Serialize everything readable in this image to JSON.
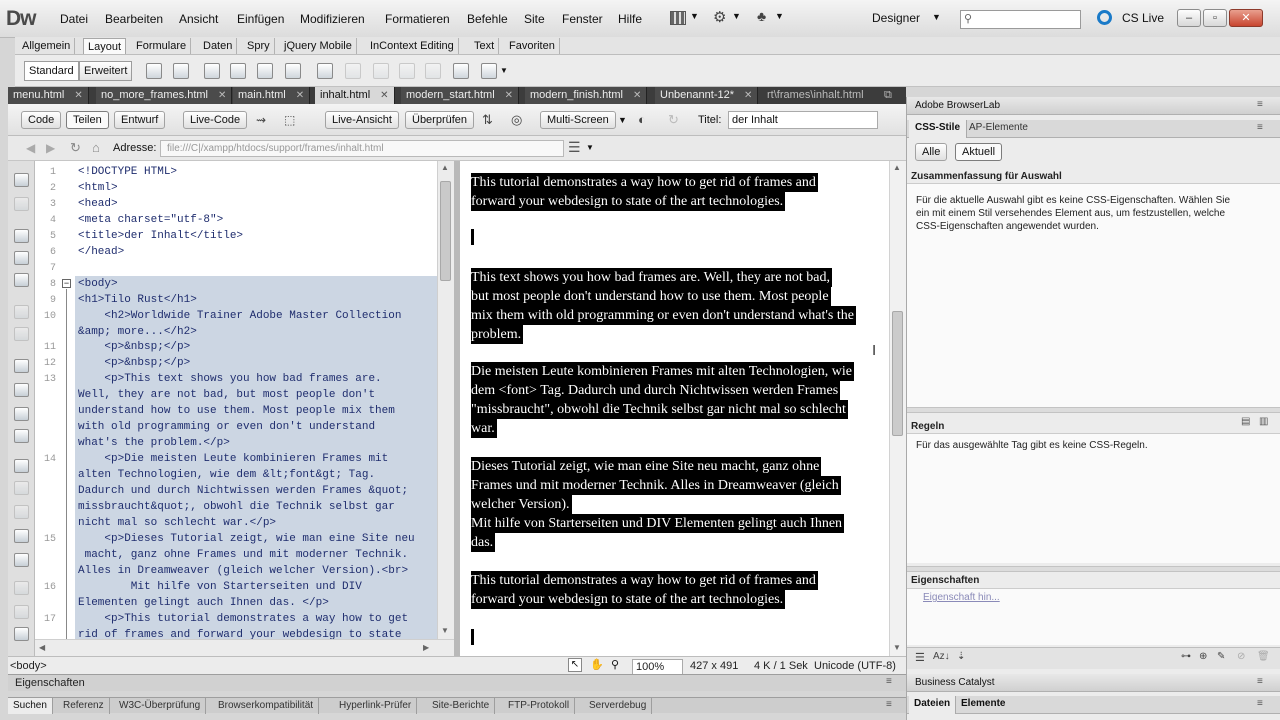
{
  "app": {
    "logo": "Dw"
  },
  "menu": [
    "Datei",
    "Bearbeiten",
    "Ansicht",
    "Einfügen",
    "Modifizieren",
    "Formatieren",
    "Befehle",
    "Site",
    "Fenster",
    "Hilfe"
  ],
  "workspace": "Designer",
  "cslive": "CS Live",
  "insert_tabs": [
    "Allgemein",
    "Layout",
    "Formulare",
    "Daten",
    "Spry",
    "jQuery Mobile",
    "InContext Editing",
    "Text",
    "Favoriten"
  ],
  "insert_active": "Layout",
  "layout_modes": [
    "Standard",
    "Erweitert"
  ],
  "doc_tabs": [
    "menu.html",
    "no_more_frames.html",
    "main.html",
    "inhalt.html",
    "modern_start.html",
    "modern_finish.html",
    "Unbenannt-12*"
  ],
  "doc_path_tab": "rt\\frames\\inhalt.html",
  "view_buttons": {
    "code": "Code",
    "split": "Teilen",
    "design": "Entwurf",
    "live_code": "Live-Code",
    "live_view": "Live-Ansicht",
    "inspect": "Überprüfen",
    "multiscreen": "Multi-Screen"
  },
  "doc_title": {
    "label": "Titel:",
    "value": "der Inhalt"
  },
  "address": {
    "label": "Adresse:",
    "value": "file:///C|/xampp/htdocs/support/frames/inhalt.html"
  },
  "code_lines": [
    {
      "n": "1",
      "t": "<!DOCTYPE HTML>"
    },
    {
      "n": "2",
      "t": "<html>"
    },
    {
      "n": "3",
      "t": "<head>"
    },
    {
      "n": "4",
      "t": "<meta charset=\"utf-8\">"
    },
    {
      "n": "5",
      "t": "<title>der Inhalt</title>"
    },
    {
      "n": "6",
      "t": "</head>"
    },
    {
      "n": "7",
      "t": ""
    },
    {
      "n": "8",
      "t": "<body>"
    },
    {
      "n": "9",
      "t": "<h1>Tilo Rust</h1>"
    },
    {
      "n": "10",
      "t": "    <h2>Worldwide Trainer Adobe Master Collection"
    },
    {
      "n": "",
      "t": "&amp; more...</h2>"
    },
    {
      "n": "11",
      "t": "    <p>&nbsp;</p>"
    },
    {
      "n": "12",
      "t": "    <p>&nbsp;</p>"
    },
    {
      "n": "13",
      "t": "    <p>This text shows you how bad frames are."
    },
    {
      "n": "",
      "t": "Well, they are not bad, but most people don't"
    },
    {
      "n": "",
      "t": "understand how to use them. Most people mix them"
    },
    {
      "n": "",
      "t": "with old programming or even don't understand"
    },
    {
      "n": "",
      "t": "what's the problem.</p>"
    },
    {
      "n": "14",
      "t": "    <p>Die meisten Leute kombinieren Frames mit"
    },
    {
      "n": "",
      "t": "alten Technologien, wie dem &lt;font&gt; Tag."
    },
    {
      "n": "",
      "t": "Dadurch und durch Nichtwissen werden Frames &quot;"
    },
    {
      "n": "",
      "t": "missbraucht&quot;, obwohl die Technik selbst gar"
    },
    {
      "n": "",
      "t": "nicht mal so schlecht war.</p>"
    },
    {
      "n": "15",
      "t": "    <p>Dieses Tutorial zeigt, wie man eine Site neu"
    },
    {
      "n": "",
      "t": " macht, ganz ohne Frames und mit moderner Technik."
    },
    {
      "n": "",
      "t": "Alles in Dreamweaver (gleich welcher Version).<br>"
    },
    {
      "n": "16",
      "t": "        Mit hilfe von Starterseiten und DIV"
    },
    {
      "n": "",
      "t": "Elementen gelingt auch Ihnen das. </p>"
    },
    {
      "n": "17",
      "t": "    <p>This tutorial demonstrates a way how to get"
    },
    {
      "n": "",
      "t": "rid of frames and forward your webdesign to state"
    }
  ],
  "design_lines": [
    "This tutorial demonstrates a way how to get rid of frames and",
    "forward your webdesign to state of the art technologies.",
    "This text shows you how bad frames are. Well, they are not bad,",
    "but most people don't understand how to use them. Most people",
    "mix them with old programming or even don't understand what's the",
    "problem.",
    "Die meisten Leute kombinieren Frames mit alten Technologien, wie",
    "dem <font> Tag. Dadurch und durch Nichtwissen werden Frames",
    "\"missbraucht\", obwohl die Technik selbst gar nicht mal so schlecht",
    "war.",
    "Dieses Tutorial zeigt, wie man eine Site neu macht, ganz ohne",
    "Frames und mit moderner Technik. Alles in Dreamweaver (gleich",
    "welcher Version).",
    "Mit hilfe von Starterseiten und DIV Elementen gelingt auch Ihnen",
    "das.",
    "This tutorial demonstrates a way how to get rid of frames and",
    "forward your webdesign to state of the art technologies."
  ],
  "status": {
    "tag": "<body>",
    "zoom": "100%",
    "size": "427 x 491",
    "weight": "4 K / 1 Sek",
    "encoding": "Unicode (UTF-8)"
  },
  "properties_title": "Eigenschaften",
  "bottom_tabs": [
    "Suchen",
    "Referenz",
    "W3C-Überprüfung",
    "Browserkompatibilität",
    "Hyperlink-Prüfer",
    "Site-Berichte",
    "FTP-Protokoll",
    "Serverdebug"
  ],
  "right": {
    "browserlab": "Adobe BrowserLab",
    "css_tabs": [
      "CSS-Stile",
      "AP-Elemente"
    ],
    "css_modes": [
      "Alle",
      "Aktuell"
    ],
    "summary_title": "Zusammenfassung für Auswahl",
    "summary_text": [
      "Für die aktuelle Auswahl gibt es keine CSS-Eigenschaften. Wählen Sie",
      "ein mit einem Stil versehendes Element aus, um festzustellen, welche",
      "CSS-Eigenschaften angewendet wurden."
    ],
    "rules_title": "Regeln",
    "rules_text": "Für das ausgewählte Tag gibt es keine CSS-Regeln.",
    "props_title": "Eigenschaften",
    "props_add": "Eigenschaft hin...",
    "business": "Business Catalyst",
    "files_tabs": [
      "Dateien",
      "Elemente"
    ]
  },
  "colors": {
    "selection": "#ccd6e3",
    "code_text": "#1f2d6e",
    "highlight": "#000000"
  }
}
